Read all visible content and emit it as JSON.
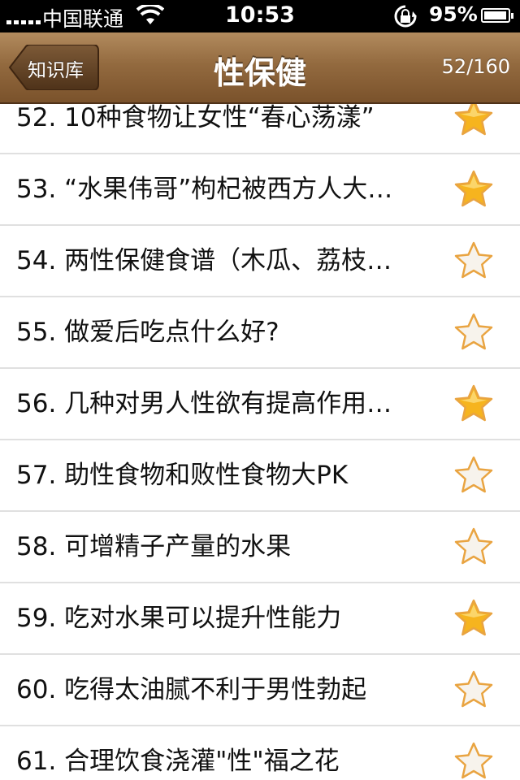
{
  "status_bar": {
    "carrier": "中国联通",
    "time": "10:53",
    "battery_percent": "95%",
    "battery_level": 0.95,
    "signal_icon": "signal-bars-icon",
    "wifi_icon": "wifi-icon",
    "lock_icon": "rotation-lock-icon"
  },
  "nav": {
    "back_label": "知识库",
    "title": "性保健",
    "counter": "52/160"
  },
  "colors": {
    "star_filled": "#f6b41e",
    "star_empty": "#f7f3ec",
    "star_outline": "#e9a441",
    "nav_brown": "#936a3f"
  },
  "items": [
    {
      "label": "52. 10种食物让女性“春心荡漾”",
      "favorite": true
    },
    {
      "label": "53. “水果伟哥”枸杞被西方人大…",
      "favorite": true
    },
    {
      "label": "54. 两性保健食谱（木瓜、荔枝…",
      "favorite": false
    },
    {
      "label": "55. 做爱后吃点什么好?",
      "favorite": false
    },
    {
      "label": "56. 几种对男人性欲有提高作用…",
      "favorite": true
    },
    {
      "label": "57. 助性食物和败性食物大PK",
      "favorite": false
    },
    {
      "label": "58. 可增精子产量的水果",
      "favorite": false
    },
    {
      "label": "59. 吃对水果可以提升性能力",
      "favorite": true
    },
    {
      "label": "60. 吃得太油腻不利于男性勃起",
      "favorite": false
    },
    {
      "label": "61. 合理饮食浇灌\"性\"福之花",
      "favorite": false
    }
  ]
}
